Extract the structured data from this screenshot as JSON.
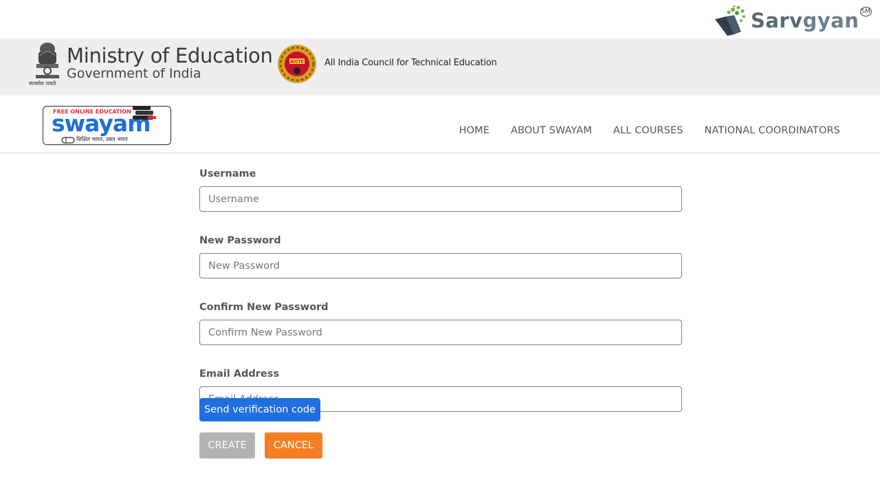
{
  "watermark": {
    "brand_part1": "Sarv",
    "brand_part2": "gyan",
    "trademark": "SM"
  },
  "banner": {
    "ministry_title": "Ministry of Education",
    "ministry_subtitle": "Government of India",
    "emblem_caption": "सत्यमेव जयते",
    "aicte_name": "All India Council for Technical Education"
  },
  "logo": {
    "free_text": "FREE ONLINE EDUCATION",
    "wordmark": "swayam",
    "tagline": "शिक्षित भारत, उन्नत भारत"
  },
  "nav": {
    "items": [
      {
        "label": "HOME"
      },
      {
        "label": "ABOUT SWAYAM"
      },
      {
        "label": "ALL COURSES"
      },
      {
        "label": "NATIONAL COORDINATORS"
      }
    ]
  },
  "form": {
    "username_label": "Username",
    "username_placeholder": "Username",
    "username_value": "",
    "new_password_label": "New Password",
    "new_password_placeholder": "New Password",
    "new_password_value": "",
    "confirm_password_label": "Confirm New Password",
    "confirm_password_placeholder": "Confirm New Password",
    "confirm_password_value": "",
    "email_label": "Email Address",
    "email_placeholder": "Email Address",
    "email_value": "",
    "verify_button": "Send verification code",
    "create_button": "CREATE",
    "cancel_button": "CANCEL"
  },
  "colors": {
    "verify_button_bg": "#1f6fe0",
    "create_button_bg": "#b3b3b3",
    "cancel_button_bg": "#f47f24",
    "banner_bg": "#eeeeee",
    "swayam_blue": "#1e6fd8"
  }
}
